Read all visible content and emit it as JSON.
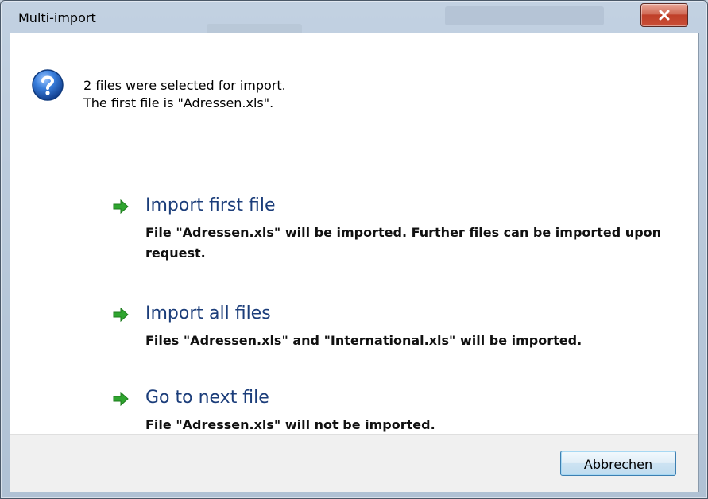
{
  "window": {
    "title": "Multi-import"
  },
  "icons": {
    "dialog": "question-icon",
    "option": "green-arrow-icon",
    "close": "close-icon"
  },
  "intro": {
    "line1": "2 files were selected for import.",
    "line2": "The first file is \"Adressen.xls\"."
  },
  "options": [
    {
      "title": "Import first file",
      "description": "File \"Adressen.xls\" will be imported. Further files can be imported upon request."
    },
    {
      "title": "Import all files",
      "description": "Files \"Adressen.xls\" and \"International.xls\" will be imported."
    },
    {
      "title": "Go to next file",
      "description": "File \"Adressen.xls\" will not be imported."
    }
  ],
  "footer": {
    "cancel_label": "Abbrechen"
  },
  "colors": {
    "option_title": "#1b3d7a",
    "arrow_green": "#2fa52f",
    "close_red": "#c94e36",
    "question_blue": "#1f5fbf"
  }
}
